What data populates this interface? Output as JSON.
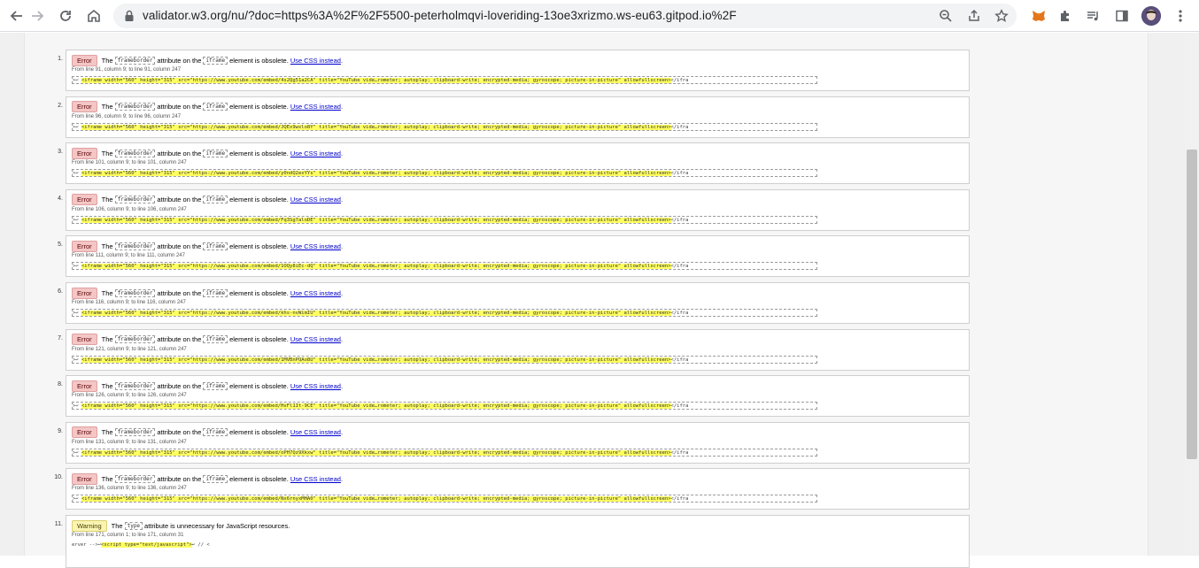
{
  "browser": {
    "url": "validator.w3.org/nu/?doc=https%3A%2F%2F5500-peterholmqvi-loveriding-13oe3xrizmo.ws-eu63.gitpod.io%2F"
  },
  "labels": {
    "error": "Error",
    "warning": "Warning",
    "use_css": "Use CSS instead",
    "the": "The",
    "attr_on_the": "attribute on the",
    "element_obsolete": "element is obsolete."
  },
  "messages": [
    {
      "num": "1.",
      "attr": "frameborder",
      "elem": "iframe",
      "loc": "From line 91, column 9; to line 91, column 247",
      "prefix": ">↩      ",
      "code": "<iframe width=\"560\" height=\"315\" src=\"https://www.youtube.com/embed/4s2Qg51a2CA\" title=\"YouTube vide…rometer; autoplay; clipboard-write; encrypted-media; gyroscope; picture-in-picture\" allowfullscreen>",
      "suffix": "</ifra"
    },
    {
      "num": "2.",
      "attr": "frameborder",
      "elem": "iframe",
      "loc": "From line 96, column 9; to line 96, column 247",
      "prefix": ">↩      ",
      "code": "<iframe width=\"560\" height=\"315\" src=\"https://www.youtube.com/embed/JQEx9wxlo8Y\" title=\"YouTube vide…rometer; autoplay; clipboard-write; encrypted-media; gyroscope; picture-in-picture\" allowfullscreen>",
      "suffix": "</ifra"
    },
    {
      "num": "3.",
      "attr": "frameborder",
      "elem": "iframe",
      "loc": "From line 101, column 9; to line 101, column 247",
      "prefix": ">↩      ",
      "code": "<iframe width=\"560\" height=\"315\" src=\"https://www.youtube.com/embed/y0ndQ2exYYs\" title=\"YouTube vide…rometer; autoplay; clipboard-write; encrypted-media; gyroscope; picture-in-picture\" allowfullscreen>",
      "suffix": "</ifra"
    },
    {
      "num": "4.",
      "attr": "frameborder",
      "elem": "iframe",
      "loc": "From line 106, column 9; to line 106, column 247",
      "prefix": ">↩      ",
      "code": "<iframe width=\"560\" height=\"315\" src=\"https://www.youtube.com/embed/Fq3Sg7aloDE\" title=\"YouTube vide…rometer; autoplay; clipboard-write; encrypted-media; gyroscope; picture-in-picture\" allowfullscreen>",
      "suffix": "</ifra"
    },
    {
      "num": "5.",
      "attr": "frameborder",
      "elem": "iframe",
      "loc": "From line 111, column 9; to line 111, column 247",
      "prefix": ">↩      ",
      "code": "<iframe width=\"560\" height=\"315\" src=\"https://www.youtube.com/embed/1OQy8iEc-dQ\" title=\"YouTube vide…rometer; autoplay; clipboard-write; encrypted-media; gyroscope; picture-in-picture\" allowfullscreen>",
      "suffix": "</ifra"
    },
    {
      "num": "6.",
      "attr": "frameborder",
      "elem": "iframe",
      "loc": "From line 116, column 9; to line 116, column 247",
      "prefix": ">↩      ",
      "code": "<iframe width=\"560\" height=\"315\" src=\"https://www.youtube.com/embed/khs-nvWimIU\" title=\"YouTube vide…rometer; autoplay; clipboard-write; encrypted-media; gyroscope; picture-in-picture\" allowfullscreen>",
      "suffix": "</ifra"
    },
    {
      "num": "7.",
      "attr": "frameborder",
      "elem": "iframe",
      "loc": "From line 121, column 9; to line 121, column 247",
      "prefix": ">↩      ",
      "code": "<iframe width=\"560\" height=\"315\" src=\"https://www.youtube.com/embed/1MVBnPQAo8U\" title=\"YouTube vide…rometer; autoplay; clipboard-write; encrypted-media; gyroscope; picture-in-picture\" allowfullscreen>",
      "suffix": "</ifra"
    },
    {
      "num": "8.",
      "attr": "frameborder",
      "elem": "iframe",
      "loc": "From line 126, column 9; to line 126, column 247",
      "prefix": ">↩      ",
      "code": "<iframe width=\"560\" height=\"315\" src=\"https://www.youtube.com/embed/HvFl1It-9CE\" title=\"YouTube vide…rometer; autoplay; clipboard-write; encrypted-media; gyroscope; picture-in-picture\" allowfullscreen>",
      "suffix": "</ifra"
    },
    {
      "num": "9.",
      "attr": "frameborder",
      "elem": "iframe",
      "loc": "From line 131, column 9; to line 131, column 247",
      "prefix": ">↩      ",
      "code": "<iframe width=\"560\" height=\"315\" src=\"https://www.youtube.com/embed/oPH7Qz9Xkxw\" title=\"YouTube vide…rometer; autoplay; clipboard-write; encrypted-media; gyroscope; picture-in-picture\" allowfullscreen>",
      "suffix": "</ifra"
    },
    {
      "num": "10.",
      "attr": "frameborder",
      "elem": "iframe",
      "loc": "From line 136, column 9; to line 136, column 247",
      "prefix": ">↩      ",
      "code": "<iframe width=\"560\" height=\"315\" src=\"https://www.youtube.com/embed/Nx6rnyxMHA0\" title=\"YouTube vide…rometer; autoplay; clipboard-write; encrypted-media; gyroscope; picture-in-picture\" allowfullscreen>",
      "suffix": "</ifra"
    }
  ],
  "warning": {
    "num": "11.",
    "pre": "The",
    "attr": "type",
    "text": "attribute is unnecessary for JavaScript resources.",
    "loc": "From line 171, column 1; to line 171, column 31",
    "prefix": "erver -->↩",
    "code": "<script type=\"text/javascript\">",
    "suffix": "↩    // <"
  }
}
